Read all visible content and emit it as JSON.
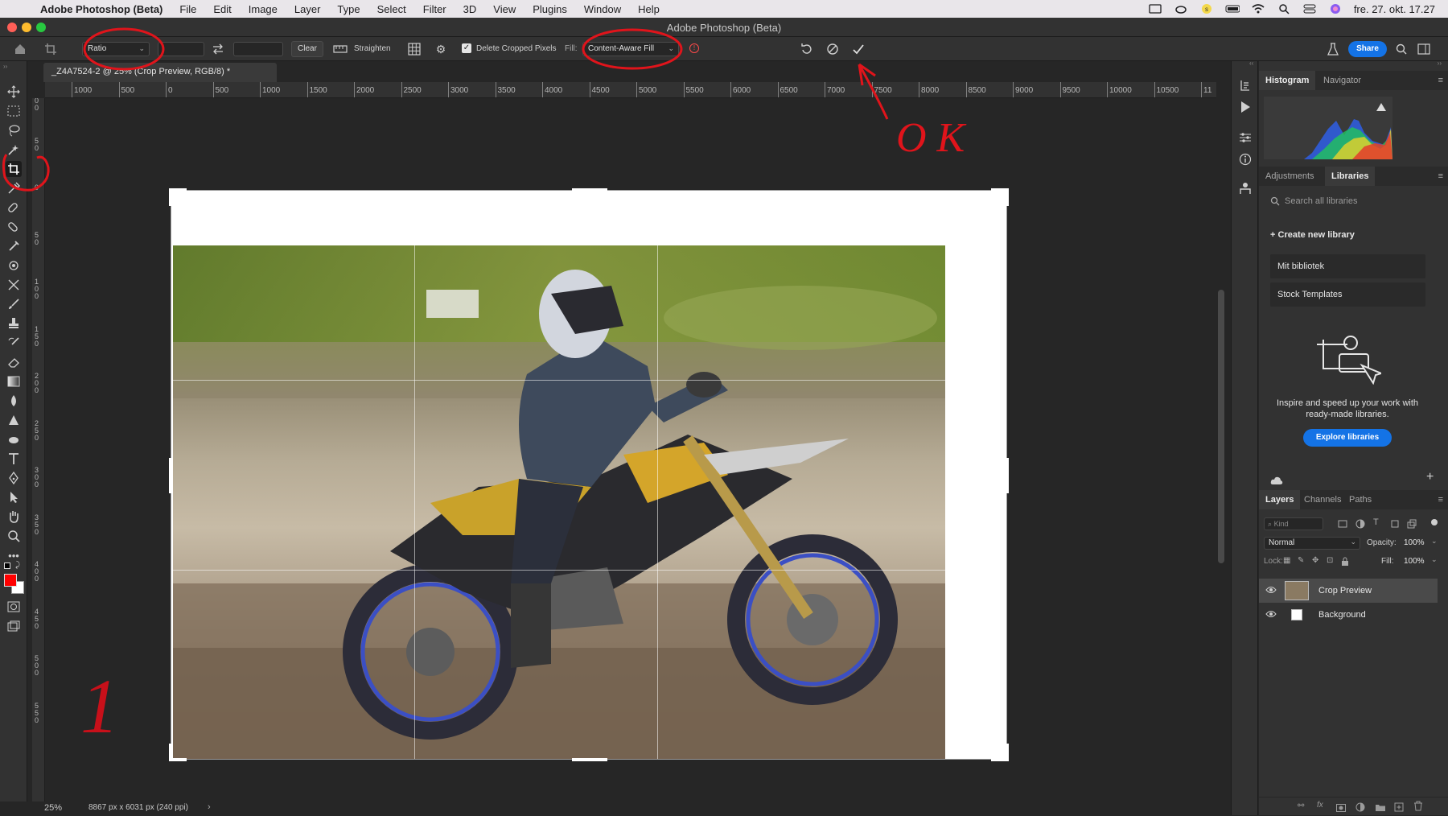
{
  "menubar": {
    "app": "Adobe Photoshop (Beta)",
    "menus": [
      "File",
      "Edit",
      "Image",
      "Layer",
      "Type",
      "Select",
      "Filter",
      "3D",
      "View",
      "Plugins",
      "Window",
      "Help"
    ],
    "clock": "fre. 27. okt. 17.27"
  },
  "window": {
    "title": "Adobe Photoshop (Beta)"
  },
  "options": {
    "ratio_select": "Ratio",
    "clear_label": "Clear",
    "straighten_label": "Straighten",
    "delete_cropped_label": "Delete Cropped Pixels",
    "delete_cropped_checked": true,
    "fill_label": "Fill:",
    "fill_value": "Content-Aware Fill",
    "share_label": "Share"
  },
  "document": {
    "tab_title": "_Z4A7524-2 @ 25% (Crop Preview, RGB/8) *"
  },
  "ruler": {
    "top_labels": [
      "1000",
      "500",
      "0",
      "500",
      "1000",
      "1500",
      "2000",
      "2500",
      "3000",
      "3500",
      "4000",
      "4500",
      "5000",
      "5500",
      "6000",
      "6500",
      "7000",
      "7500",
      "8000",
      "8500",
      "9000",
      "9500",
      "10000",
      "10500",
      "11"
    ],
    "left_labels": [
      "1 0 0",
      "5 0",
      "0",
      "5 0",
      "1 0 0",
      "1 5 0",
      "2 0 0",
      "2 5 0",
      "3 0 0",
      "3 5 0",
      "4 0 0",
      "4 5 0",
      "5 0 0",
      "5 5 0"
    ]
  },
  "status": {
    "zoom": "25%",
    "doc_info": "8867 px x 6031 px (240 ppi)"
  },
  "panels": {
    "top_tabs": [
      "Histogram",
      "Navigator"
    ],
    "mid_tabs": [
      "Adjustments",
      "Libraries"
    ],
    "search_placeholder": "Search all libraries",
    "create_library": "Create new library",
    "libraries": [
      "Mit bibliotek",
      "Stock Templates"
    ],
    "promo_text": "Inspire and speed up your work with ready-made libraries.",
    "explore_button": "Explore libraries",
    "layer_tabs": [
      "Layers",
      "Channels",
      "Paths"
    ],
    "kind_placeholder": "Kind",
    "blend_mode": "Normal",
    "opacity_label": "Opacity:",
    "opacity_value": "100%",
    "lock_label": "Lock:",
    "fill_label": "Fill:",
    "fill_value": "100%",
    "layers": [
      {
        "name": "Crop Preview",
        "selected": true
      },
      {
        "name": "Background",
        "selected": false
      }
    ]
  },
  "annotations": {
    "ok_text": "O K",
    "step_number": "1"
  },
  "colors": {
    "accent": "#1473e6",
    "annotation": "#e0141b",
    "foreground": "#ff0000",
    "background": "#ffffff"
  }
}
